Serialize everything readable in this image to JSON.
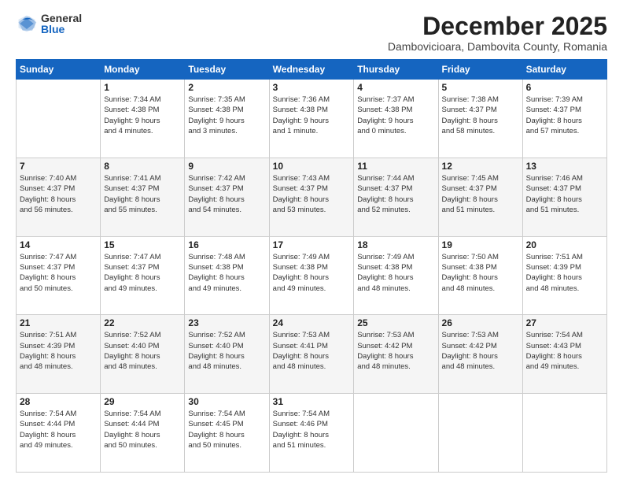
{
  "logo": {
    "general": "General",
    "blue": "Blue"
  },
  "title": "December 2025",
  "subtitle": "Dambovicioara, Dambovita County, Romania",
  "days_header": [
    "Sunday",
    "Monday",
    "Tuesday",
    "Wednesday",
    "Thursday",
    "Friday",
    "Saturday"
  ],
  "weeks": [
    [
      {
        "day": "",
        "info": ""
      },
      {
        "day": "1",
        "info": "Sunrise: 7:34 AM\nSunset: 4:38 PM\nDaylight: 9 hours\nand 4 minutes."
      },
      {
        "day": "2",
        "info": "Sunrise: 7:35 AM\nSunset: 4:38 PM\nDaylight: 9 hours\nand 3 minutes."
      },
      {
        "day": "3",
        "info": "Sunrise: 7:36 AM\nSunset: 4:38 PM\nDaylight: 9 hours\nand 1 minute."
      },
      {
        "day": "4",
        "info": "Sunrise: 7:37 AM\nSunset: 4:38 PM\nDaylight: 9 hours\nand 0 minutes."
      },
      {
        "day": "5",
        "info": "Sunrise: 7:38 AM\nSunset: 4:37 PM\nDaylight: 8 hours\nand 58 minutes."
      },
      {
        "day": "6",
        "info": "Sunrise: 7:39 AM\nSunset: 4:37 PM\nDaylight: 8 hours\nand 57 minutes."
      }
    ],
    [
      {
        "day": "7",
        "info": "Sunrise: 7:40 AM\nSunset: 4:37 PM\nDaylight: 8 hours\nand 56 minutes."
      },
      {
        "day": "8",
        "info": "Sunrise: 7:41 AM\nSunset: 4:37 PM\nDaylight: 8 hours\nand 55 minutes."
      },
      {
        "day": "9",
        "info": "Sunrise: 7:42 AM\nSunset: 4:37 PM\nDaylight: 8 hours\nand 54 minutes."
      },
      {
        "day": "10",
        "info": "Sunrise: 7:43 AM\nSunset: 4:37 PM\nDaylight: 8 hours\nand 53 minutes."
      },
      {
        "day": "11",
        "info": "Sunrise: 7:44 AM\nSunset: 4:37 PM\nDaylight: 8 hours\nand 52 minutes."
      },
      {
        "day": "12",
        "info": "Sunrise: 7:45 AM\nSunset: 4:37 PM\nDaylight: 8 hours\nand 51 minutes."
      },
      {
        "day": "13",
        "info": "Sunrise: 7:46 AM\nSunset: 4:37 PM\nDaylight: 8 hours\nand 51 minutes."
      }
    ],
    [
      {
        "day": "14",
        "info": "Sunrise: 7:47 AM\nSunset: 4:37 PM\nDaylight: 8 hours\nand 50 minutes."
      },
      {
        "day": "15",
        "info": "Sunrise: 7:47 AM\nSunset: 4:37 PM\nDaylight: 8 hours\nand 49 minutes."
      },
      {
        "day": "16",
        "info": "Sunrise: 7:48 AM\nSunset: 4:38 PM\nDaylight: 8 hours\nand 49 minutes."
      },
      {
        "day": "17",
        "info": "Sunrise: 7:49 AM\nSunset: 4:38 PM\nDaylight: 8 hours\nand 49 minutes."
      },
      {
        "day": "18",
        "info": "Sunrise: 7:49 AM\nSunset: 4:38 PM\nDaylight: 8 hours\nand 48 minutes."
      },
      {
        "day": "19",
        "info": "Sunrise: 7:50 AM\nSunset: 4:38 PM\nDaylight: 8 hours\nand 48 minutes."
      },
      {
        "day": "20",
        "info": "Sunrise: 7:51 AM\nSunset: 4:39 PM\nDaylight: 8 hours\nand 48 minutes."
      }
    ],
    [
      {
        "day": "21",
        "info": "Sunrise: 7:51 AM\nSunset: 4:39 PM\nDaylight: 8 hours\nand 48 minutes."
      },
      {
        "day": "22",
        "info": "Sunrise: 7:52 AM\nSunset: 4:40 PM\nDaylight: 8 hours\nand 48 minutes."
      },
      {
        "day": "23",
        "info": "Sunrise: 7:52 AM\nSunset: 4:40 PM\nDaylight: 8 hours\nand 48 minutes."
      },
      {
        "day": "24",
        "info": "Sunrise: 7:53 AM\nSunset: 4:41 PM\nDaylight: 8 hours\nand 48 minutes."
      },
      {
        "day": "25",
        "info": "Sunrise: 7:53 AM\nSunset: 4:42 PM\nDaylight: 8 hours\nand 48 minutes."
      },
      {
        "day": "26",
        "info": "Sunrise: 7:53 AM\nSunset: 4:42 PM\nDaylight: 8 hours\nand 48 minutes."
      },
      {
        "day": "27",
        "info": "Sunrise: 7:54 AM\nSunset: 4:43 PM\nDaylight: 8 hours\nand 49 minutes."
      }
    ],
    [
      {
        "day": "28",
        "info": "Sunrise: 7:54 AM\nSunset: 4:44 PM\nDaylight: 8 hours\nand 49 minutes."
      },
      {
        "day": "29",
        "info": "Sunrise: 7:54 AM\nSunset: 4:44 PM\nDaylight: 8 hours\nand 50 minutes."
      },
      {
        "day": "30",
        "info": "Sunrise: 7:54 AM\nSunset: 4:45 PM\nDaylight: 8 hours\nand 50 minutes."
      },
      {
        "day": "31",
        "info": "Sunrise: 7:54 AM\nSunset: 4:46 PM\nDaylight: 8 hours\nand 51 minutes."
      },
      {
        "day": "",
        "info": ""
      },
      {
        "day": "",
        "info": ""
      },
      {
        "day": "",
        "info": ""
      }
    ]
  ]
}
